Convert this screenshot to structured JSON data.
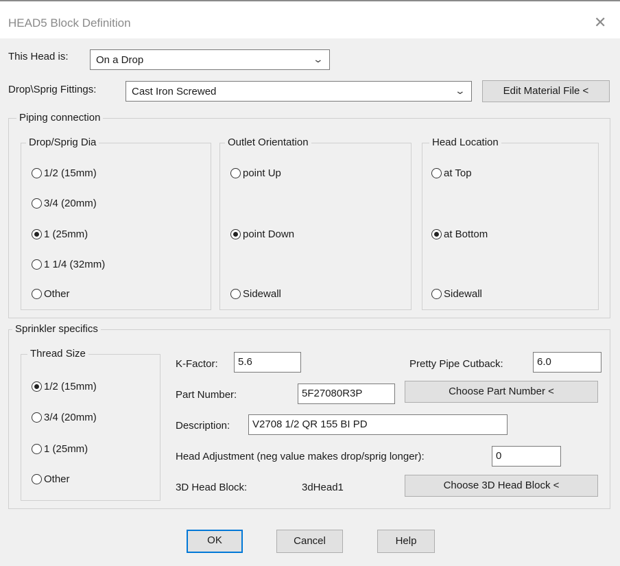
{
  "window": {
    "title": "HEAD5 Block Definition",
    "close_glyph": "✕"
  },
  "head": {
    "label": "This Head is:",
    "value": "On a Drop"
  },
  "fittings": {
    "label": "Drop\\Sprig Fittings:",
    "value": "Cast Iron Screwed",
    "edit_button": "Edit Material File <"
  },
  "piping": {
    "label": "Piping connection",
    "dia": {
      "label": "Drop/Sprig Dia",
      "options": [
        "1/2 (15mm)",
        "3/4 (20mm)",
        "1 (25mm)",
        "1 1/4 (32mm)",
        "Other"
      ],
      "selected": "1 (25mm)"
    },
    "outlet": {
      "label": "Outlet Orientation",
      "options": [
        "point Up",
        "point Down",
        "Sidewall"
      ],
      "selected": "point Down"
    },
    "location": {
      "label": "Head Location",
      "options": [
        "at Top",
        "at Bottom",
        "Sidewall"
      ],
      "selected": "at Bottom"
    }
  },
  "sprinkler": {
    "label": "Sprinkler specifics",
    "thread": {
      "label": "Thread Size",
      "options": [
        "1/2 (15mm)",
        "3/4 (20mm)",
        "1 (25mm)",
        "Other"
      ],
      "selected": "1/2 (15mm)"
    },
    "kfactor": {
      "label": "K-Factor:",
      "value": "5.6"
    },
    "cutback": {
      "label": "Pretty Pipe Cutback:",
      "value": "6.0"
    },
    "part": {
      "label": "Part Number:",
      "value": "5F27080R3P",
      "button": "Choose Part Number <"
    },
    "description": {
      "label": "Description:",
      "value": "V2708 1/2 QR 155 BI PD"
    },
    "adjustment": {
      "label": "Head Adjustment (neg value makes drop/sprig longer):",
      "value": "0"
    },
    "block3d": {
      "label": "3D Head Block:",
      "value": "3dHead1",
      "button": "Choose 3D Head Block <"
    }
  },
  "buttons": {
    "ok": "OK",
    "cancel": "Cancel",
    "help": "Help"
  },
  "icons": {
    "dropdown": "chevron-down-icon",
    "close": "close-icon",
    "radio": "radio-button-icon"
  }
}
